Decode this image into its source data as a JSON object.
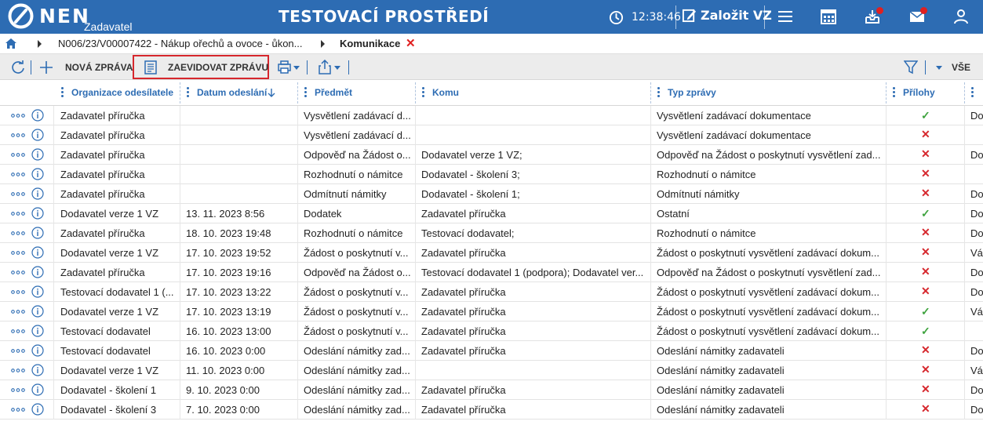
{
  "header": {
    "logo_text": "NEN",
    "logo_sub": "Zadavatel",
    "env_title": "TESTOVACÍ PROSTŘEDÍ",
    "clock": "12:38:46",
    "create_label": "Založit VZ",
    "icons": [
      "clock-icon",
      "edit-icon",
      "menu-icon",
      "calendar-icon",
      "inbox-icon",
      "mail-icon",
      "user-icon"
    ],
    "accent": "#2d6cb3",
    "badge_color": "#e02020"
  },
  "breadcrumb": {
    "path_item": "N006/23/V00007422 - Nákup ořechů a ovoce - ůkon...",
    "current": "Komunikace"
  },
  "toolbar": {
    "new_message": "NOVÁ ZPRÁVA",
    "register_message": "ZAEVIDOVAT ZPRÁVU",
    "filter_all": "VŠE"
  },
  "table": {
    "columns": {
      "sender": "Organizace odesílatele",
      "sent": "Datum odeslání",
      "subject": "Předmět",
      "to": "Komu",
      "type": "Typ zprávy",
      "attachments": "Přílohy"
    },
    "rows": [
      {
        "sender": "Zadavatel příručka",
        "sent": "",
        "subject": "Vysvětlení zadávací d...",
        "to": "",
        "type": "Vysvětlení zadávací dokumentace",
        "att": "yes",
        "extra": "Do"
      },
      {
        "sender": "Zadavatel příručka",
        "sent": "",
        "subject": "Vysvětlení zadávací d...",
        "to": "",
        "type": "Vysvětlení zadávací dokumentace",
        "att": "no",
        "extra": ""
      },
      {
        "sender": "Zadavatel příručka",
        "sent": "",
        "subject": "Odpověď na Žádost o...",
        "to": "Dodavatel verze 1 VZ;",
        "type": "Odpověď na Žádost o poskytnutí vysvětlení zad...",
        "att": "no",
        "extra": "Do"
      },
      {
        "sender": "Zadavatel příručka",
        "sent": "",
        "subject": "Rozhodnutí o námitce",
        "to": "Dodavatel - školení 3;",
        "type": "Rozhodnutí o námitce",
        "att": "no",
        "extra": ""
      },
      {
        "sender": "Zadavatel příručka",
        "sent": "",
        "subject": "Odmítnutí námitky",
        "to": "Dodavatel - školení 1;",
        "type": "Odmítnutí námitky",
        "att": "no",
        "extra": "Do"
      },
      {
        "sender": "Dodavatel verze 1 VZ",
        "sent": "13. 11. 2023 8:56",
        "subject": "Dodatek",
        "to": "Zadavatel příručka",
        "type": "Ostatní",
        "att": "yes",
        "extra": "Do"
      },
      {
        "sender": "Zadavatel příručka",
        "sent": "18. 10. 2023 19:48",
        "subject": "Rozhodnutí o námitce",
        "to": "Testovací dodavatel;",
        "type": "Rozhodnutí o námitce",
        "att": "no",
        "extra": "Do"
      },
      {
        "sender": "Dodavatel verze 1 VZ",
        "sent": "17. 10. 2023 19:52",
        "subject": "Žádost o poskytnutí v...",
        "to": "Zadavatel příručka",
        "type": "Žádost o poskytnutí vysvětlení zadávací dokum...",
        "att": "no",
        "extra": "Vá"
      },
      {
        "sender": "Zadavatel příručka",
        "sent": "17. 10. 2023 19:16",
        "subject": "Odpověď na Žádost o...",
        "to": "Testovací dodavatel 1 (podpora); Dodavatel ver...",
        "type": "Odpověď na Žádost o poskytnutí vysvětlení zad...",
        "att": "no",
        "extra": "Do"
      },
      {
        "sender": "Testovací dodavatel 1 (...",
        "sent": "17. 10. 2023 13:22",
        "subject": "Žádost o poskytnutí v...",
        "to": "Zadavatel příručka",
        "type": "Žádost o poskytnutí vysvětlení zadávací dokum...",
        "att": "no",
        "extra": "Do"
      },
      {
        "sender": "Dodavatel verze 1 VZ",
        "sent": "17. 10. 2023 13:19",
        "subject": "Žádost o poskytnutí v...",
        "to": "Zadavatel příručka",
        "type": "Žádost o poskytnutí vysvětlení zadávací dokum...",
        "att": "yes",
        "extra": "Vá"
      },
      {
        "sender": "Testovací dodavatel",
        "sent": "16. 10. 2023 13:00",
        "subject": "Žádost o poskytnutí v...",
        "to": "Zadavatel příručka",
        "type": "Žádost o poskytnutí vysvětlení zadávací dokum...",
        "att": "yes",
        "extra": ""
      },
      {
        "sender": "Testovací dodavatel",
        "sent": "16. 10. 2023 0:00",
        "subject": "Odeslání námitky zad...",
        "to": "Zadavatel příručka",
        "type": "Odeslání námitky zadavateli",
        "att": "no",
        "extra": "Do"
      },
      {
        "sender": "Dodavatel verze 1 VZ",
        "sent": "11. 10. 2023 0:00",
        "subject": "Odeslání námitky zad...",
        "to": "",
        "type": "Odeslání námitky zadavateli",
        "att": "no",
        "extra": "Vá"
      },
      {
        "sender": "Dodavatel - školení 1",
        "sent": "9. 10. 2023 0:00",
        "subject": "Odeslání námitky zad...",
        "to": "Zadavatel příručka",
        "type": "Odeslání námitky zadavateli",
        "att": "no",
        "extra": "Do"
      },
      {
        "sender": "Dodavatel - školení 3",
        "sent": "7. 10. 2023 0:00",
        "subject": "Odeslání námitky zad...",
        "to": "Zadavatel příručka",
        "type": "Odeslání námitky zadavateli",
        "att": "no",
        "extra": "Do"
      }
    ]
  }
}
